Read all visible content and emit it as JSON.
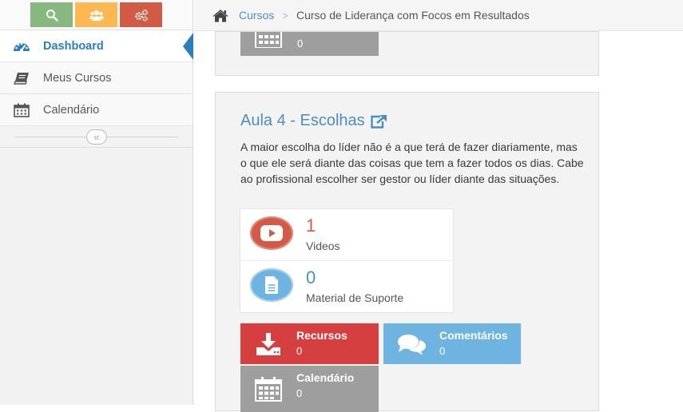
{
  "shortcuts": [
    {
      "name": "search-icon",
      "color": "#87b87f"
    },
    {
      "name": "users-icon",
      "color": "#ffb752"
    },
    {
      "name": "cogs-icon",
      "color": "#d15b47"
    }
  ],
  "sidebar": {
    "items": [
      {
        "label": "Dashboard",
        "icon": "dashboard-icon",
        "active": true
      },
      {
        "label": "Meus Cursos",
        "icon": "book-icon"
      },
      {
        "label": "Calendário",
        "icon": "calendar-icon"
      }
    ],
    "collapse_glyph": "«"
  },
  "breadcrumb": {
    "home_icon": "home-icon",
    "link": "Cursos",
    "separator": ">",
    "current": "Curso de Liderança com Focos em Resultados"
  },
  "top_card": {
    "tile": {
      "icon": "calendar-icon",
      "count": "0",
      "color": "#9e9e9e"
    }
  },
  "lesson": {
    "title": "Aula 4 - Escolhas",
    "title_icon": "external-link-icon",
    "description": "A maior escolha do líder não é a que terá de fazer diariamente, mas o que ele será diante das coisas que tem a fazer todos os dias. Cabe ao profissional escolher ser gestor ou líder diante das situações.",
    "stats": [
      {
        "count": "1",
        "label": "Videos",
        "icon": "youtube-play-icon",
        "color": "#d15b47",
        "num_color": "#d15b47"
      },
      {
        "count": "0",
        "label": "Material de Suporte",
        "icon": "document-icon",
        "color": "#6fb3e0",
        "num_color": "#4c8fbd"
      }
    ],
    "tiles": [
      {
        "title": "Recursos",
        "count": "0",
        "icon": "download-icon",
        "color": "#d53f40"
      },
      {
        "title": "Comentários",
        "count": "0",
        "icon": "comments-icon",
        "color": "#6fb3e0"
      },
      {
        "title": "Calendário",
        "count": "0",
        "icon": "calendar-icon",
        "color": "#9e9e9e"
      }
    ]
  }
}
